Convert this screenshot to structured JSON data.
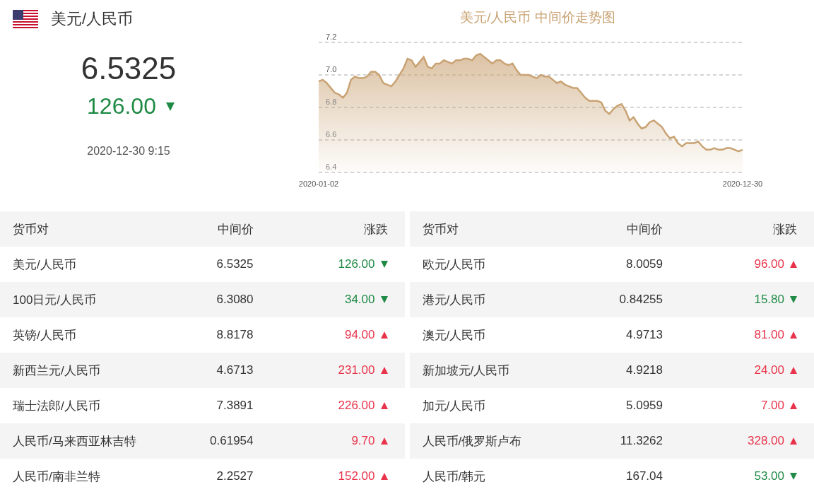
{
  "header": {
    "pair": "美元/人民币",
    "rate": "6.5325",
    "change": "126.00",
    "up": false,
    "time": "2020-12-30 9:15"
  },
  "chart": {
    "title": "美元/人民币 中间价走势图",
    "start_date": "2020-01-02",
    "end_date": "2020-12-30",
    "chart_data": {
      "type": "area",
      "grid": true,
      "ylim": [
        6.4,
        7.2
      ],
      "yticks": [
        6.4,
        6.6,
        6.8,
        {
          "value": 7,
          "label": "7.0"
        },
        7.2
      ],
      "values": [
        6.96,
        6.97,
        6.95,
        6.92,
        6.89,
        6.88,
        6.86,
        6.89,
        6.97,
        6.99,
        6.98,
        6.98,
        6.99,
        7.02,
        7.02,
        7.0,
        6.95,
        6.94,
        6.93,
        6.96,
        7.0,
        7.04,
        7.1,
        7.09,
        7.05,
        7.08,
        7.11,
        7.05,
        7.04,
        7.07,
        7.07,
        7.09,
        7.08,
        7.07,
        7.09,
        7.09,
        7.1,
        7.1,
        7.09,
        7.12,
        7.13,
        7.11,
        7.09,
        7.07,
        7.09,
        7.09,
        7.07,
        7.06,
        7.07,
        7.03,
        7.0,
        7.0,
        7.0,
        6.99,
        6.98,
        7.0,
        6.99,
        6.99,
        6.97,
        6.95,
        6.96,
        6.94,
        6.93,
        6.92,
        6.92,
        6.89,
        6.86,
        6.84,
        6.84,
        6.84,
        6.83,
        6.78,
        6.76,
        6.79,
        6.81,
        6.82,
        6.78,
        6.72,
        6.74,
        6.7,
        6.67,
        6.68,
        6.71,
        6.72,
        6.7,
        6.68,
        6.64,
        6.61,
        6.62,
        6.58,
        6.56,
        6.58,
        6.58,
        6.58,
        6.59,
        6.56,
        6.54,
        6.54,
        6.55,
        6.54,
        6.54,
        6.55,
        6.55,
        6.54,
        6.53,
        6.54
      ]
    }
  },
  "tables": [
    {
      "columns": [
        "货币对",
        "中间价",
        "涨跌"
      ],
      "rows": [
        {
          "pair": "美元/人民币",
          "rate": "6.5325",
          "change": "126.00",
          "up": false
        },
        {
          "pair": "100日元/人民币",
          "rate": "6.3080",
          "change": "34.00",
          "up": false
        },
        {
          "pair": "英镑/人民币",
          "rate": "8.8178",
          "change": "94.00",
          "up": true
        },
        {
          "pair": "新西兰元/人民币",
          "rate": "4.6713",
          "change": "231.00",
          "up": true
        },
        {
          "pair": "瑞士法郎/人民币",
          "rate": "7.3891",
          "change": "226.00",
          "up": true
        },
        {
          "pair": "人民币/马来西亚林吉特",
          "rate": "0.61954",
          "change": "9.70",
          "up": true
        },
        {
          "pair": "人民币/南非兰特",
          "rate": "2.2527",
          "change": "152.00",
          "up": true
        }
      ]
    },
    {
      "columns": [
        "货币对",
        "中间价",
        "涨跌"
      ],
      "rows": [
        {
          "pair": "欧元/人民币",
          "rate": "8.0059",
          "change": "96.00",
          "up": true
        },
        {
          "pair": "港元/人民币",
          "rate": "0.84255",
          "change": "15.80",
          "up": false
        },
        {
          "pair": "澳元/人民币",
          "rate": "4.9713",
          "change": "81.00",
          "up": true
        },
        {
          "pair": "新加坡元/人民币",
          "rate": "4.9218",
          "change": "24.00",
          "up": true
        },
        {
          "pair": "加元/人民币",
          "rate": "5.0959",
          "change": "7.00",
          "up": true
        },
        {
          "pair": "人民币/俄罗斯卢布",
          "rate": "11.3262",
          "change": "328.00",
          "up": true
        },
        {
          "pair": "人民币/韩元",
          "rate": "167.04",
          "change": "53.00",
          "up": false
        }
      ]
    }
  ]
}
